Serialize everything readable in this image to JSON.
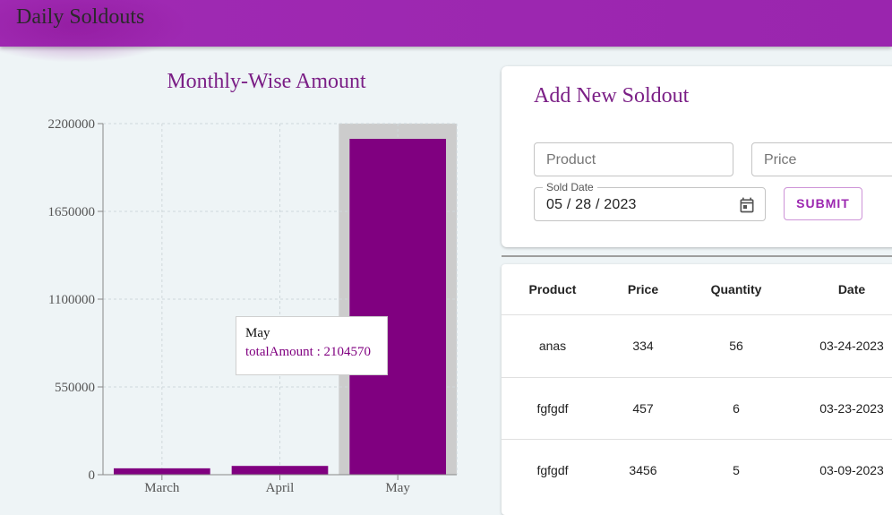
{
  "app": {
    "title": "Daily Soldouts"
  },
  "chart": {
    "title": "Monthly-Wise Amount",
    "tooltip": {
      "label": "May",
      "item": "totalAmount : 2104570"
    }
  },
  "chart_data": {
    "type": "bar",
    "categories": [
      "March",
      "April",
      "May"
    ],
    "series": [
      {
        "name": "totalAmount",
        "values": [
          40000,
          55000,
          2104570
        ]
      }
    ],
    "yticks": [
      0,
      550000,
      1100000,
      1650000,
      2200000
    ],
    "ylim": [
      0,
      2200000
    ],
    "grid": true,
    "bar_color": "#800080",
    "highlight_category": "May"
  },
  "form": {
    "title": "Add New Soldout",
    "product_placeholder": "Product",
    "price_placeholder": "Price",
    "date_label": "Sold Date",
    "date_value": "05 / 28 / 2023",
    "submit_label": "SUBMIT"
  },
  "table": {
    "headers": [
      "Product",
      "Price",
      "Quantity",
      "Date"
    ],
    "rows": [
      [
        "anas",
        "334",
        "56",
        "03-24-2023"
      ],
      [
        "fgfgdf",
        "457",
        "6",
        "03-23-2023"
      ],
      [
        "fgfgdf",
        "3456",
        "5",
        "03-09-2023"
      ]
    ]
  },
  "colors": {
    "appbar": "#9c27b0",
    "accent": "#800080",
    "title": "#7b1f86"
  }
}
